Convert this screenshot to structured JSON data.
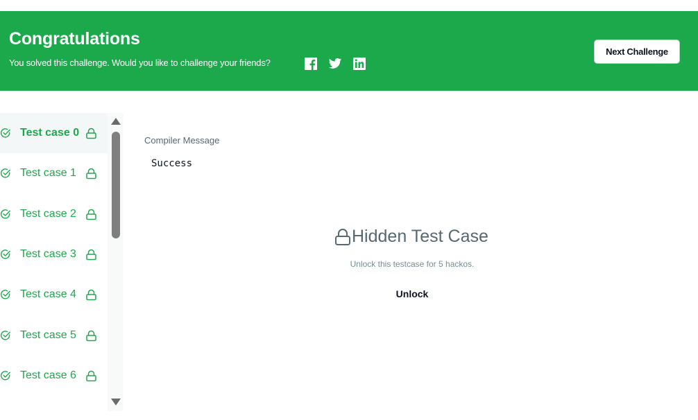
{
  "banner": {
    "title": "Congratulations",
    "subtitle": "You solved this challenge. Would you like to challenge your friends?",
    "share_icons": [
      "facebook-icon",
      "twitter-icon",
      "linkedin-icon"
    ],
    "next_button_label": "Next Challenge",
    "background_color": "#1ba94c"
  },
  "testcases": {
    "items": [
      {
        "label": "Test case 0",
        "status": "passed",
        "locked": true,
        "active": true
      },
      {
        "label": "Test case 1",
        "status": "passed",
        "locked": true,
        "active": false
      },
      {
        "label": "Test case 2",
        "status": "passed",
        "locked": true,
        "active": false
      },
      {
        "label": "Test case 3",
        "status": "passed",
        "locked": true,
        "active": false
      },
      {
        "label": "Test case 4",
        "status": "passed",
        "locked": true,
        "active": false
      },
      {
        "label": "Test case 5",
        "status": "passed",
        "locked": true,
        "active": false
      },
      {
        "label": "Test case 6",
        "status": "passed",
        "locked": true,
        "active": false
      }
    ],
    "accent_color": "#1ba94c"
  },
  "compiler": {
    "label": "Compiler Message",
    "output": "Success"
  },
  "hidden_case": {
    "title": "Hidden Test Case",
    "description": "Unlock this testcase for 5 hackos.",
    "unlock_label": "Unlock",
    "icon": "lock-icon"
  }
}
